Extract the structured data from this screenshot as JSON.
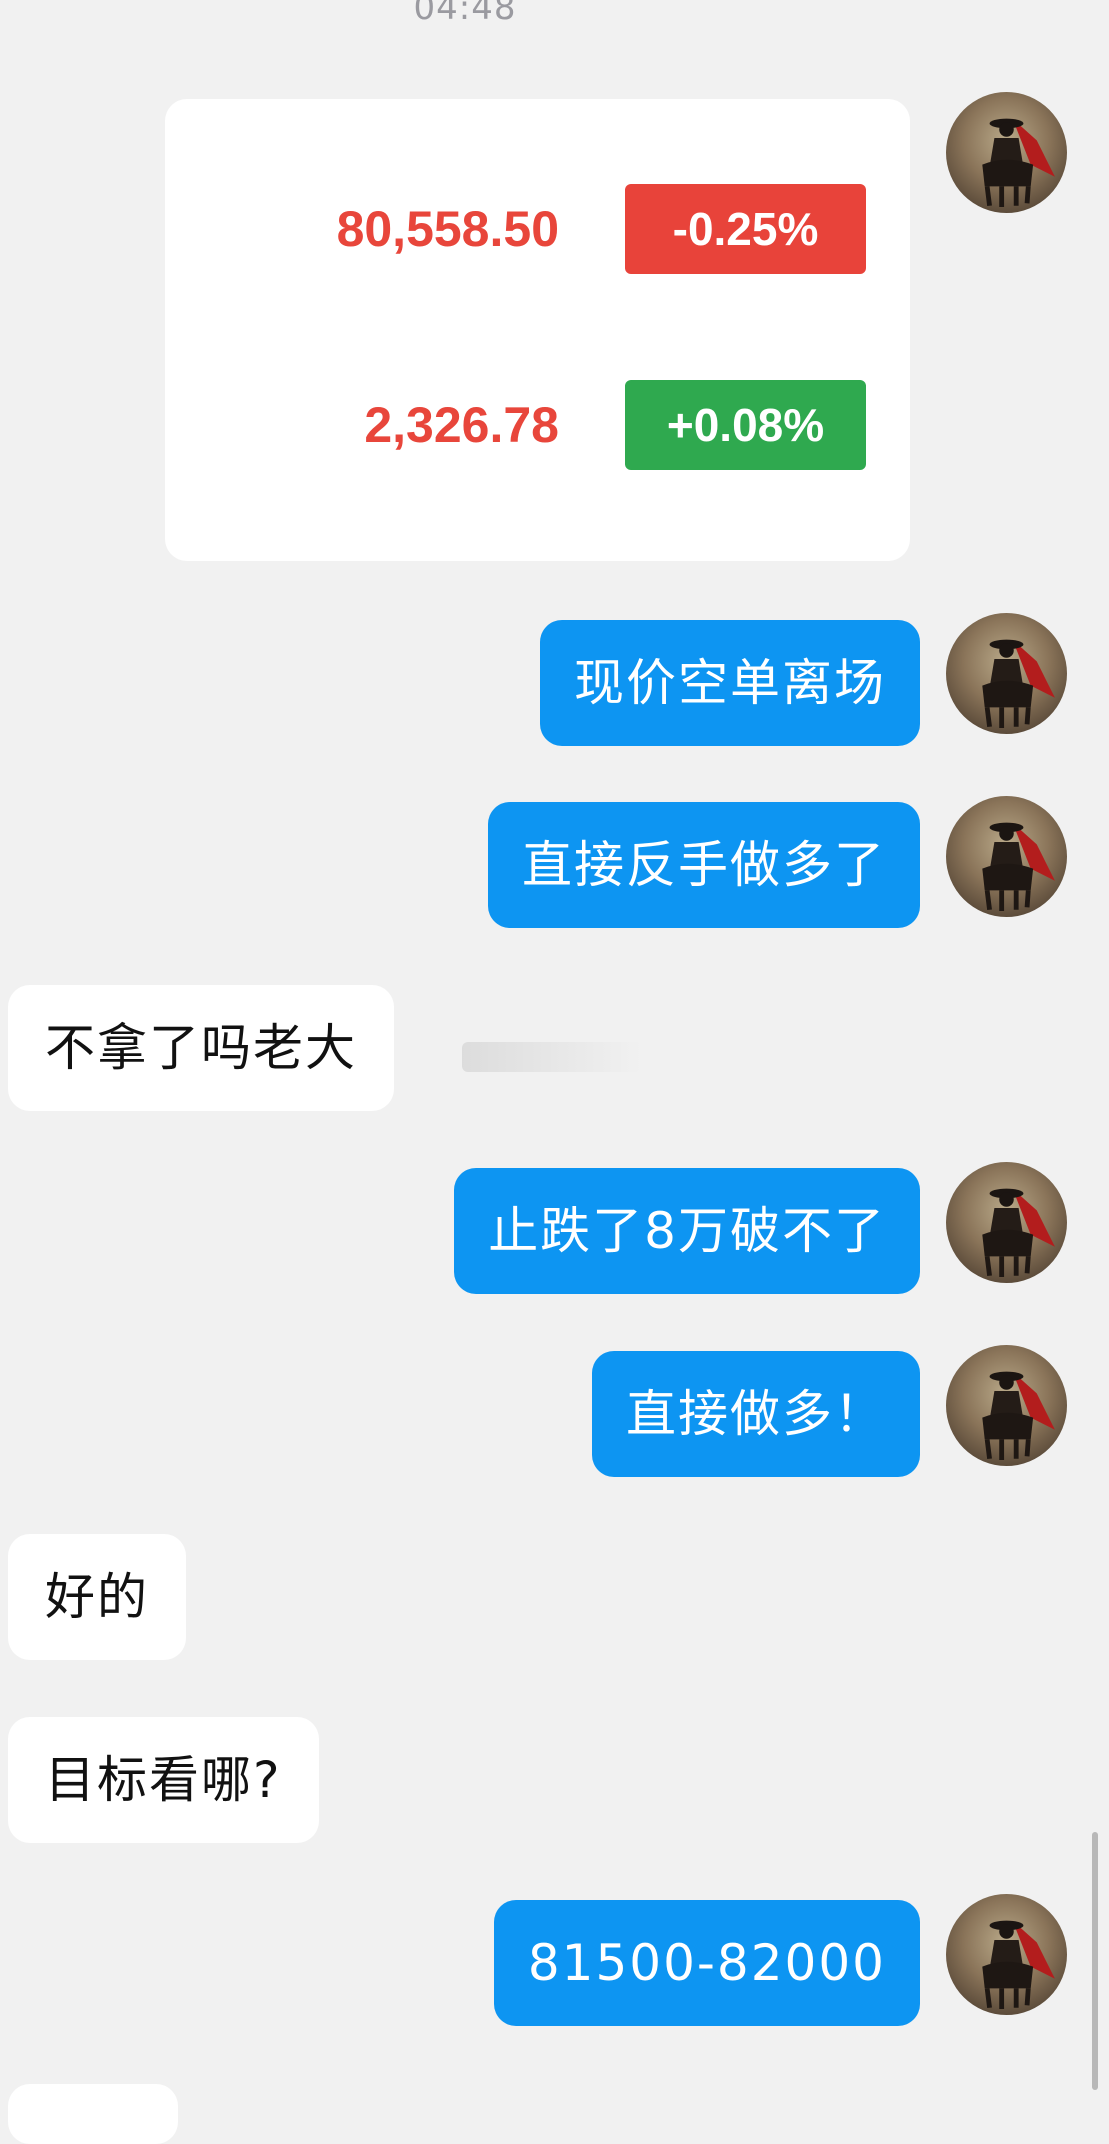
{
  "chat": {
    "timestamp": "04:48",
    "price_card": {
      "rows": [
        {
          "price": "80,558.50",
          "change": "-0.25%",
          "change_color": "#e8433a"
        },
        {
          "price": "2,326.78",
          "change": "+0.08%",
          "change_color": "#2fa94f"
        }
      ]
    },
    "messages": [
      {
        "side": "out",
        "text": "现价空单离场"
      },
      {
        "side": "out",
        "text": "直接反手做多了"
      },
      {
        "side": "in",
        "text": "不拿了吗老大"
      },
      {
        "side": "out",
        "text": "止跌了8万破不了"
      },
      {
        "side": "out",
        "text": "直接做多！"
      },
      {
        "side": "in",
        "text": "好的"
      },
      {
        "side": "in",
        "text": "目标看哪?"
      },
      {
        "side": "out",
        "text": "81500-82000"
      }
    ]
  },
  "colors": {
    "background": "#f1f1f1",
    "outgoing_bubble": "#0d95f2",
    "incoming_bubble": "#ffffff",
    "price_text": "#e8463b"
  },
  "icons": {
    "avatar": "warrior-with-red-cape-avatar"
  }
}
